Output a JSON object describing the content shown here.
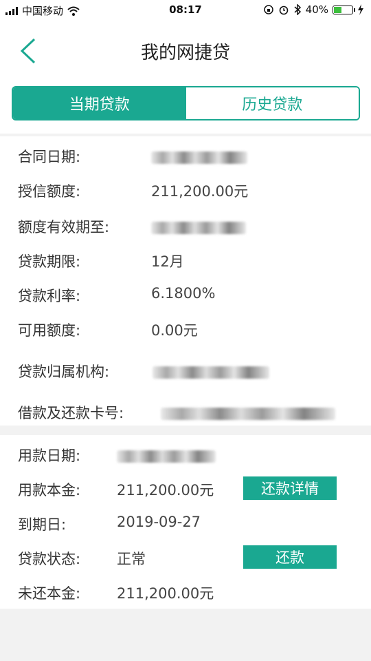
{
  "status_bar": {
    "carrier": "中国移动",
    "time": "08:17",
    "battery": "40%"
  },
  "nav": {
    "title": "我的网捷贷"
  },
  "tabs": [
    {
      "label": "当期贷款"
    },
    {
      "label": "历史贷款"
    }
  ],
  "loan_info": [
    {
      "label": "合同日期:",
      "value": ""
    },
    {
      "label": "授信额度:",
      "value": "211,200.00元"
    },
    {
      "label": "额度有效期至:",
      "value": ""
    },
    {
      "label": "贷款期限:",
      "value": "12月"
    },
    {
      "label": "贷款利率:",
      "value": "6.1800%"
    },
    {
      "label": "可用额度:",
      "value": "0.00元"
    },
    {
      "label": "贷款归属机构:",
      "value": ""
    },
    {
      "label": "借款及还款卡号:",
      "value": ""
    }
  ],
  "usage": [
    {
      "label": "用款日期:",
      "value": ""
    },
    {
      "label": "用款本金:",
      "value": "211,200.00元"
    },
    {
      "label": "到期日:",
      "value": "2019-09-27"
    },
    {
      "label": "贷款状态:",
      "value": "正常"
    },
    {
      "label": "未还本金:",
      "value": "211,200.00元"
    }
  ],
  "buttons": {
    "repay_details": "还款详情",
    "repay": "还款"
  },
  "colors": {
    "accent": "#1aa891"
  }
}
